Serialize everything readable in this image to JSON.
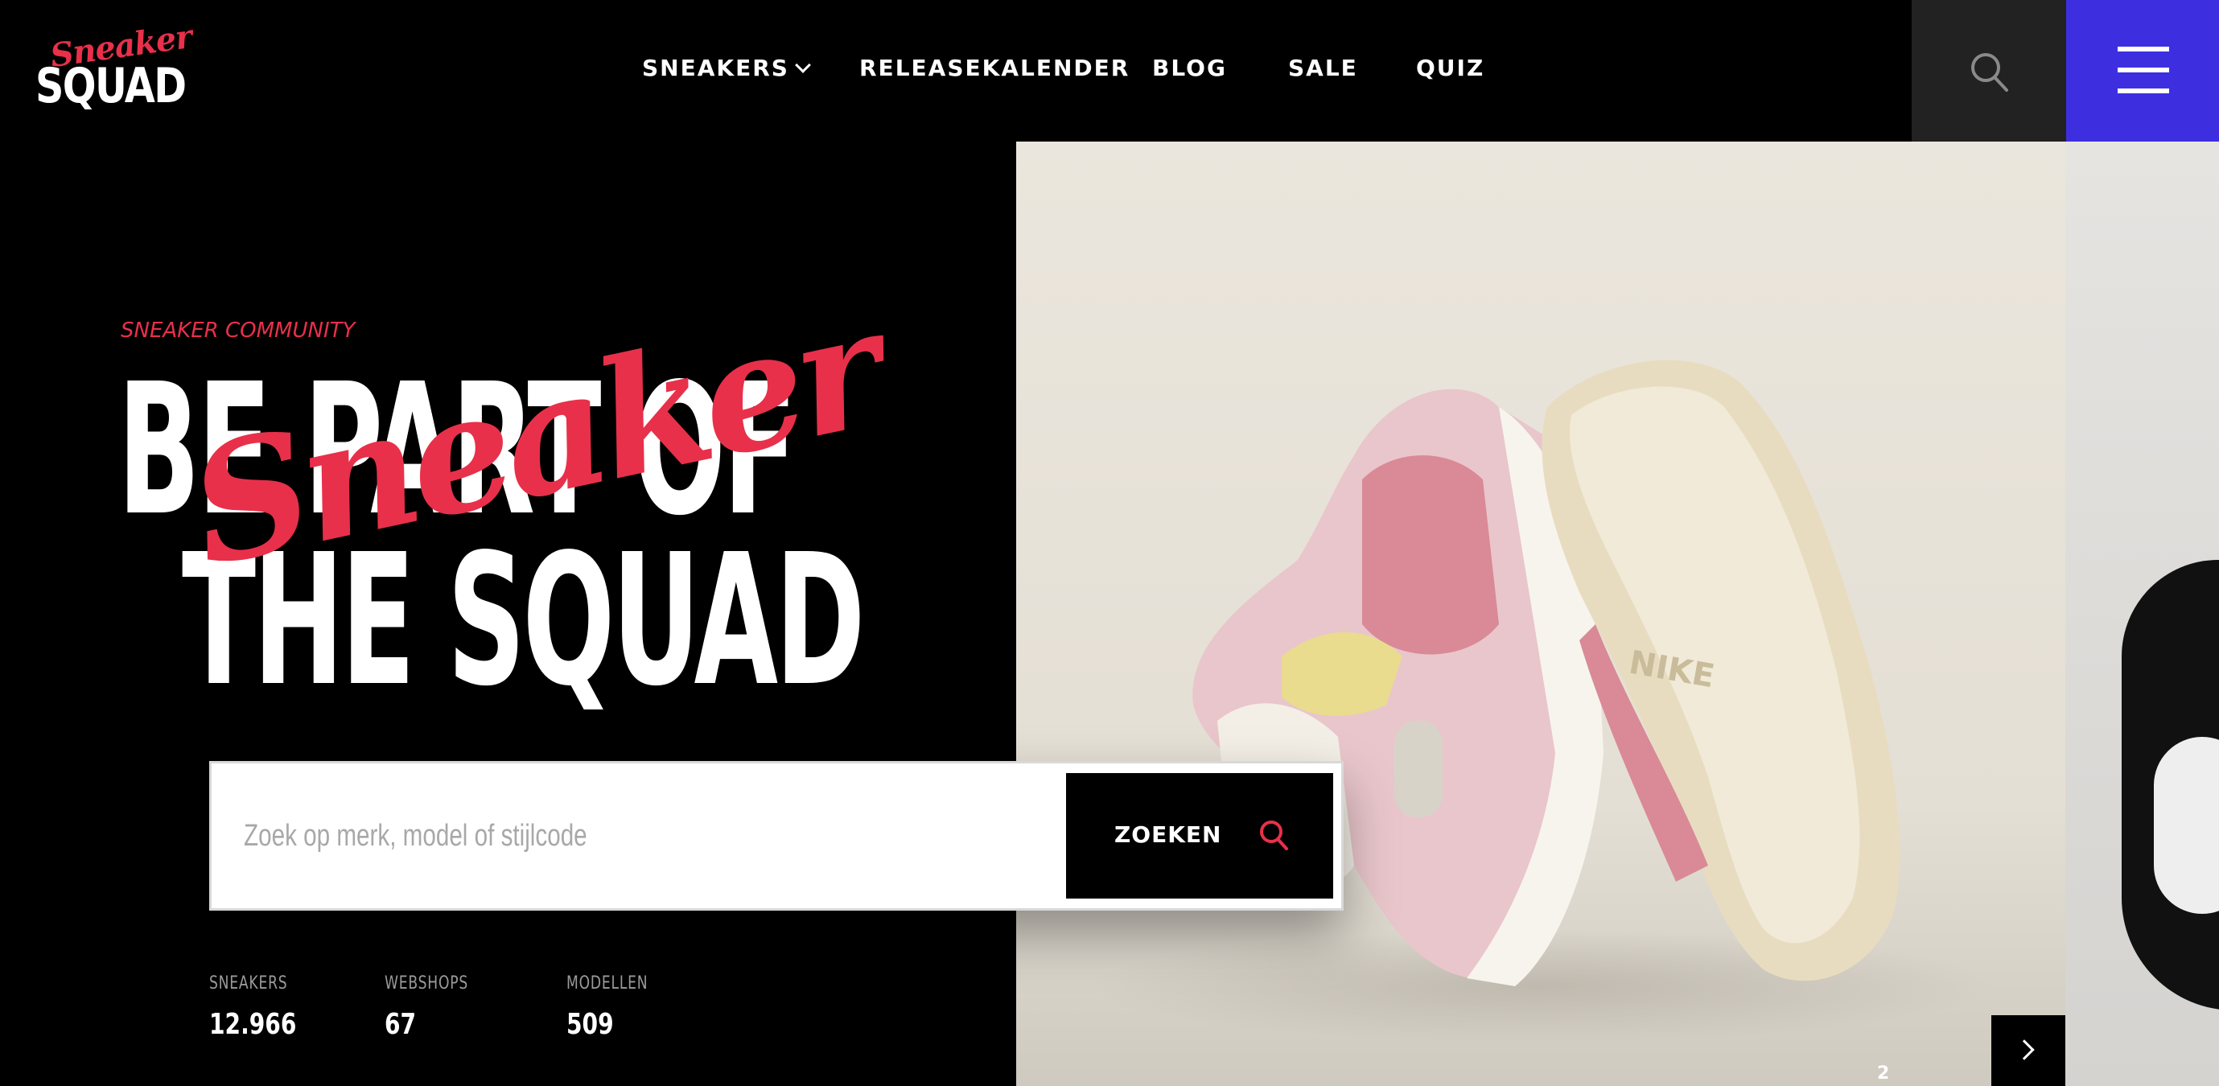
{
  "brand": {
    "logo_script": "Sneaker",
    "logo_main": "SQUAD",
    "accent_color": "#e8304a",
    "menu_color": "#3d2fe0"
  },
  "nav": {
    "items": [
      {
        "label": "SNEAKERS",
        "has_dropdown": true
      },
      {
        "label": "RELEASEKALENDER"
      },
      {
        "label": "BLOG"
      },
      {
        "label": "SALE"
      },
      {
        "label": "QUIZ"
      }
    ],
    "search_icon": "search-icon",
    "menu_icon": "hamburger-menu-icon"
  },
  "hero": {
    "eyebrow": "SNEAKER COMMUNITY",
    "title_line1": "BE PART OF",
    "title_script": "Sneaker",
    "title_line2": "THE SQUAD",
    "search": {
      "placeholder": "Zoek op merk, model of stijlcode",
      "value": "",
      "button_label": "ZOEKEN",
      "button_icon": "search-icon"
    },
    "stats": [
      {
        "label": "SNEAKERS",
        "value": "12.966"
      },
      {
        "label": "WEBSHOPS",
        "value": "67"
      },
      {
        "label": "MODELLEN",
        "value": "509"
      }
    ]
  },
  "slider": {
    "image_alt": "Pink and cream sneakers",
    "sole_text": "NIKE",
    "slide_number": "2",
    "next_icon": "chevron-right-icon"
  }
}
